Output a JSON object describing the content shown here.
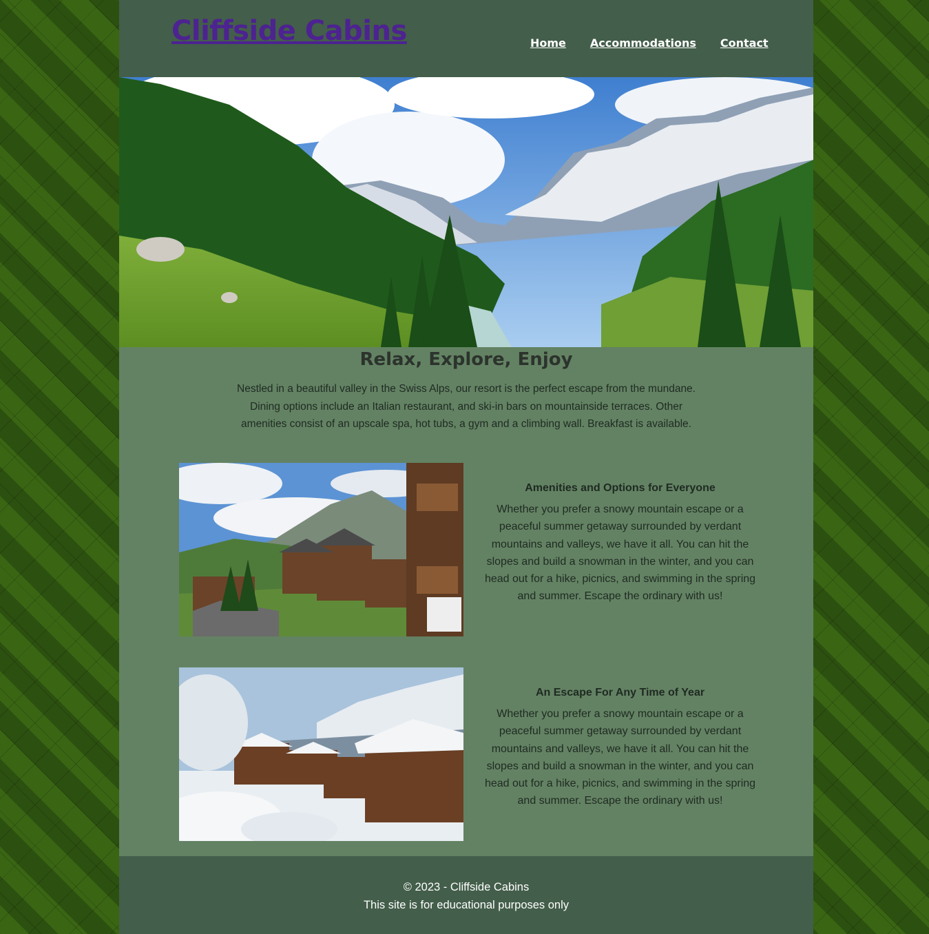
{
  "header": {
    "logo": "Cliffside Cabins",
    "nav": [
      "Home",
      "Accommodations",
      "Contact"
    ]
  },
  "hero": {
    "image": "alpine-valley-river-photo"
  },
  "main": {
    "heading": "Relax, Explore, Enjoy",
    "intro": "Nestled in a beautiful valley in the Swiss Alps, our resort is the perfect escape from the mundane. Dining options include an Italian restaurant, and ski-in bars on mountainside terraces. Other amenities consist of an upscale spa, hot tubs, a gym and a climbing wall. Breakfast is available.",
    "features": [
      {
        "image": "summer-chalet-village-photo",
        "title": "Amenities and Options for Everyone",
        "text": "Whether you prefer a snowy mountain escape or a peaceful summer getaway surrounded by verdant mountains and valleys, we have it all. You can hit the slopes and build a snowman in the winter, and you can head out for a hike, picnics, and swimming in the spring and summer. Escape the ordinary with us!"
      },
      {
        "image": "winter-chalet-village-photo",
        "title": "An Escape For Any Time of Year",
        "text": "Whether you prefer a snowy mountain escape or a peaceful summer getaway surrounded by verdant mountains and valleys, we have it all. You can hit the slopes and build a snowman in the winter, and you can head out for a hike, picnics, and swimming in the spring and summer. Escape the ordinary with us!"
      }
    ]
  },
  "footer": {
    "copyright": "© 2023 - Cliffside Cabins",
    "note": "This site is for educational purposes only"
  }
}
